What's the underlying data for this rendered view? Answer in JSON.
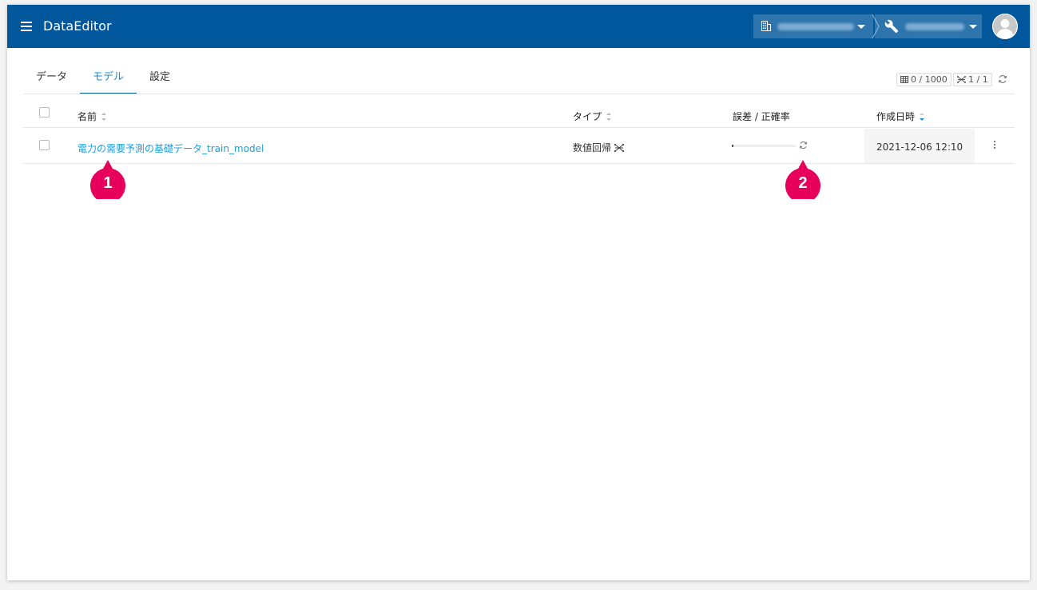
{
  "app": {
    "title": "DataEditor"
  },
  "tabs": [
    {
      "label": "データ",
      "active": false
    },
    {
      "label": "モデル",
      "active": true
    },
    {
      "label": "設定",
      "active": false
    }
  ],
  "counters": {
    "rows": "0 / 1000",
    "models": "1 / 1"
  },
  "table": {
    "headers": {
      "name": "名前",
      "type": "タイプ",
      "error": "誤差 / 正確率",
      "created": "作成日時"
    },
    "rows": [
      {
        "name": "電力の需要予測の基礎データ_train_model",
        "type": "数値回帰",
        "progress": 0.02,
        "created": "2021-12-06 12:10"
      }
    ]
  },
  "markers": [
    "1",
    "2"
  ],
  "colors": {
    "appbar": "#01579b",
    "link": "#1a9fd8",
    "marker": "#e6005c"
  }
}
